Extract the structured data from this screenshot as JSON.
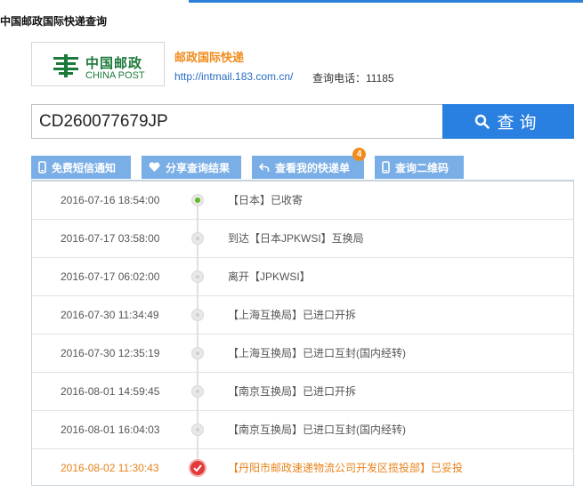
{
  "page": {
    "title": "中国邮政国际快递查询"
  },
  "logo": {
    "cn": "中国邮政",
    "en": "CHINA POST",
    "color": "#1c7a3a"
  },
  "brand": {
    "name": "邮政国际快递",
    "url": "http://intmail.183.com.cn/",
    "phone": "查询电话：11185"
  },
  "search": {
    "value": "CD260077679JP",
    "button_label": "查询",
    "button_color": "#2a80e0"
  },
  "tabs": [
    {
      "label": "免费短信通知",
      "icon": "mobile-icon"
    },
    {
      "label": "分享查询结果",
      "icon": "heart-icon"
    },
    {
      "label": "查看我的快递单",
      "icon": "return-arrow-icon",
      "badge": "4"
    },
    {
      "label": "查询二维码",
      "icon": "mobile-icon"
    }
  ],
  "timeline": [
    {
      "time": "2016-07-16 18:54:00",
      "desc": "【日本】已收寄",
      "status": "start"
    },
    {
      "time": "2016-07-17 03:58:00",
      "desc": "到达【日本JPKWSI】互换局",
      "status": "normal"
    },
    {
      "time": "2016-07-17 06:02:00",
      "desc": "离开【JPKWSI】",
      "status": "normal"
    },
    {
      "time": "2016-07-30 11:34:49",
      "desc": "【上海互换局】已进口开拆",
      "status": "normal"
    },
    {
      "time": "2016-07-30 12:35:19",
      "desc": "【上海互换局】已进口互封(国内经转)",
      "status": "normal"
    },
    {
      "time": "2016-08-01 14:59:45",
      "desc": "【南京互换局】已进口开拆",
      "status": "normal"
    },
    {
      "time": "2016-08-01 16:04:03",
      "desc": "【南京互换局】已进口互封(国内经转)",
      "status": "normal"
    },
    {
      "time": "2016-08-02 11:30:43",
      "desc": "【丹阳市邮政速递物流公司开发区揽投部】已妥投",
      "status": "delivered"
    }
  ],
  "colors": {
    "accent": "#2a80e0",
    "highlight": "#e8821a",
    "tab": "#7aaee6"
  }
}
